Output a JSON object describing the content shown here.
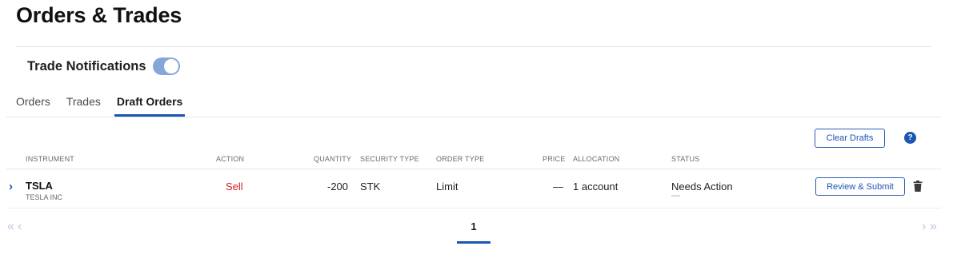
{
  "page": {
    "title": "Orders & Trades"
  },
  "notifications": {
    "label": "Trade Notifications",
    "enabled": true
  },
  "tabs": [
    {
      "label": "Orders",
      "active": false
    },
    {
      "label": "Trades",
      "active": false
    },
    {
      "label": "Draft Orders",
      "active": true
    }
  ],
  "toolbar": {
    "clear_drafts_label": "Clear Drafts",
    "help_label": "?"
  },
  "table": {
    "columns": {
      "instrument": "INSTRUMENT",
      "action": "ACTION",
      "quantity": "QUANTITY",
      "security_type": "SECURITY TYPE",
      "order_type": "ORDER TYPE",
      "price": "PRICE",
      "allocation": "ALLOCATION",
      "status": "STATUS"
    },
    "rows": [
      {
        "symbol": "TSLA",
        "name": "TESLA INC",
        "action": "Sell",
        "quantity": "-200",
        "security_type": "STK",
        "order_type": "Limit",
        "price": "—",
        "allocation": "1 account",
        "status": "Needs Action",
        "status_sub": "—",
        "review_label": "Review & Submit"
      }
    ]
  },
  "pagination": {
    "current_page": "1",
    "first": "«",
    "prev": "‹",
    "next": "›",
    "last": "»"
  },
  "colors": {
    "accent": "#1c55b4",
    "sell": "#d11f1f",
    "toggle_on": "#87a6d8"
  }
}
